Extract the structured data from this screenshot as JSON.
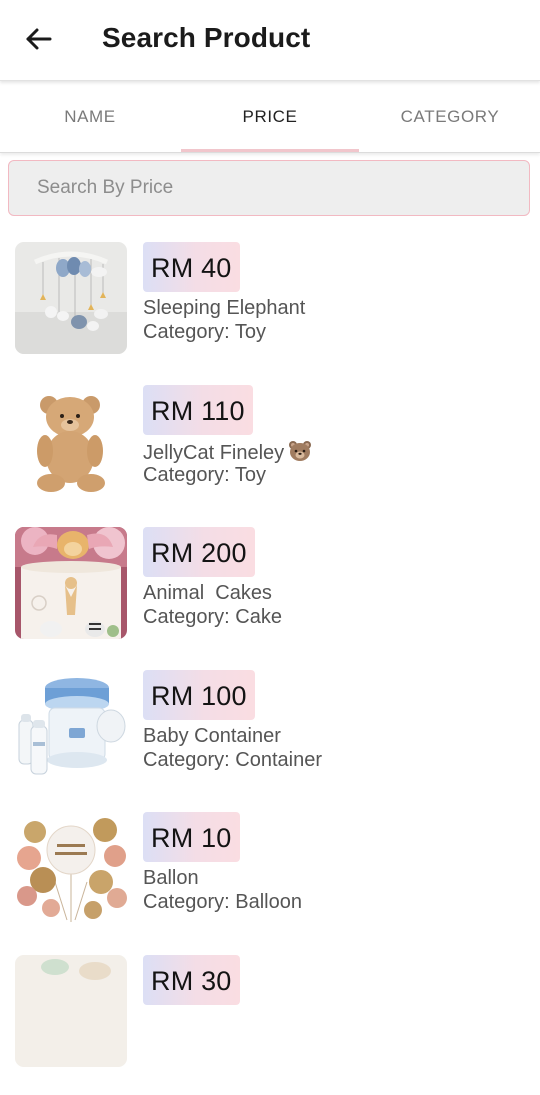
{
  "appbar": {
    "title": "Search Product",
    "back_icon": "arrow-left-icon"
  },
  "tabs": [
    {
      "label": "NAME",
      "active": false
    },
    {
      "label": "PRICE",
      "active": true
    },
    {
      "label": "CATEGORY",
      "active": false
    }
  ],
  "search": {
    "placeholder": "Search By Price",
    "value": ""
  },
  "products": [
    {
      "price": "RM 40",
      "name": "Sleeping Elephant",
      "category": "Category: Toy",
      "image": "baby-mobile-image"
    },
    {
      "price": "RM 110",
      "name": "JellyCat Fineley",
      "name_emoji": "teddy-bear-face-emoji",
      "category": "Category: Toy",
      "image": "teddy-bear-image"
    },
    {
      "price": "RM 200",
      "name": "Animal  Cakes",
      "category": "Category: Cake",
      "image": "animal-cake-image"
    },
    {
      "price": "RM 100",
      "name": "Baby Container",
      "category": "Category: Container",
      "image": "bottle-sterilizer-image"
    },
    {
      "price": "RM 10",
      "name": "Ballon",
      "category": "Category: Balloon",
      "image": "balloon-bouquet-image"
    },
    {
      "price": "RM 30",
      "name": "",
      "category": "",
      "image": "partial-product-image"
    }
  ],
  "colors": {
    "accent": "#f1c6cc",
    "search_border": "#f2b9c2",
    "price_badge_start": "#dcdff5",
    "price_badge_end": "#fadde2",
    "text_secondary": "#555555"
  }
}
